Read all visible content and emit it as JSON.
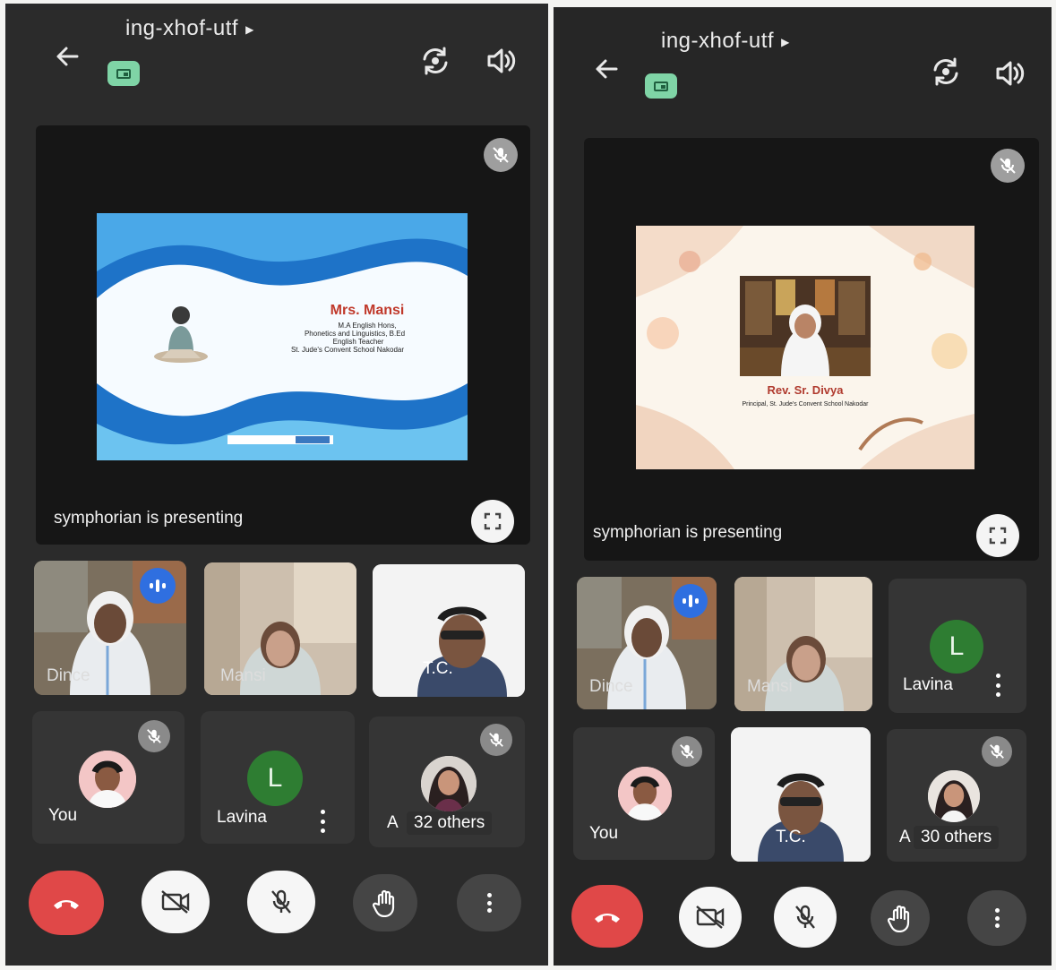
{
  "left": {
    "meeting_code": "ing-xhof-utf",
    "presenting_text": "symphorian is presenting",
    "slide": {
      "name": "Mrs. Mansi",
      "lines": [
        "M.A English Hons,",
        "Phonetics and Linguistics, B.Ed",
        "English Teacher",
        "St. Jude's Convent School Nakodar"
      ]
    },
    "participants": {
      "tile1_label": "Dince",
      "tile2_label": "Mansi",
      "tile3_label": "T.C.",
      "you_label": "You",
      "lavina_label": "Lavina",
      "lavina_initial": "L",
      "others_prefix": "A",
      "others_label": "32 others"
    }
  },
  "right": {
    "meeting_code": "ing-xhof-utf",
    "presenting_text": "symphorian is presenting",
    "slide": {
      "name": "Rev. Sr. Divya",
      "lines": [
        "Principal, St. Jude's Convent School Nakodar"
      ]
    },
    "participants": {
      "tile1_label": "Dince",
      "tile2_label": "Mansi",
      "lavina_label": "Lavina",
      "lavina_initial": "L",
      "you_label": "You",
      "tile5_label": "T.C.",
      "others_prefix": "A",
      "others_label": "30 others"
    }
  },
  "colors": {
    "end_call": "#e04848",
    "cast_badge": "#7fd4a6",
    "avatar_green": "#2e7d32",
    "speaking_blue": "#2f6fe0"
  },
  "icons": [
    "back-arrow-icon",
    "cast-icon",
    "switch-camera-icon",
    "speaker-icon",
    "mic-off-icon",
    "fullscreen-icon",
    "end-call-icon",
    "camera-off-icon",
    "raise-hand-icon",
    "more-options-icon"
  ]
}
